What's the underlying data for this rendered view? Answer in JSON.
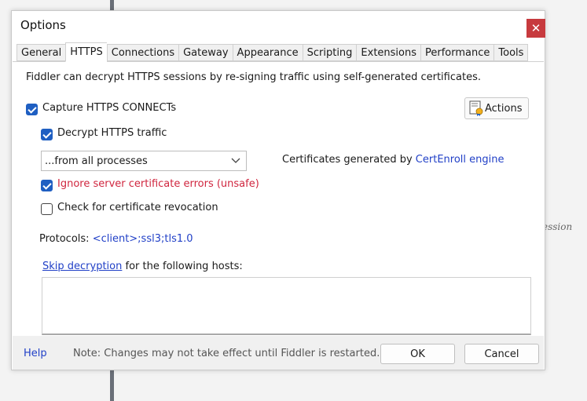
{
  "window": {
    "title": "Options",
    "close_symbol": "✕"
  },
  "tabs": [
    {
      "label": "General"
    },
    {
      "label": "HTTPS",
      "active": true
    },
    {
      "label": "Connections"
    },
    {
      "label": "Gateway"
    },
    {
      "label": "Appearance"
    },
    {
      "label": "Scripting"
    },
    {
      "label": "Extensions"
    },
    {
      "label": "Performance"
    },
    {
      "label": "Tools"
    }
  ],
  "https": {
    "description": "Fiddler can decrypt HTTPS sessions by re-signing traffic using self-generated certificates.",
    "capture_label": "Capture HTTPS CONNECTs",
    "capture_checked": true,
    "actions_label": "Actions",
    "decrypt_label": "Decrypt HTTPS traffic",
    "decrypt_checked": true,
    "process_select": "...from all processes",
    "cert_prefix": "Certificates generated by",
    "cert_link": "CertEnroll engine",
    "ignore_errors_label": "Ignore server certificate errors (unsafe)",
    "ignore_errors_checked": true,
    "revocation_label": "Check for certificate revocation",
    "revocation_checked": false,
    "protocols_prefix": "Protocols:",
    "protocols_value": "<client>;ssl3;tls1.0",
    "skip_link": "Skip decryption",
    "skip_suffix": "for the following hosts:",
    "hosts_value": ""
  },
  "footer": {
    "help": "Help",
    "note": "Note: Changes may not take effect until Fiddler is restarted.",
    "ok": "OK",
    "cancel": "Cancel"
  },
  "background": {
    "partial_text": "ession"
  },
  "colors": {
    "accent": "#1f5fc2",
    "link": "#2140c7",
    "warning": "#d0263f",
    "close": "#c73a3e"
  }
}
